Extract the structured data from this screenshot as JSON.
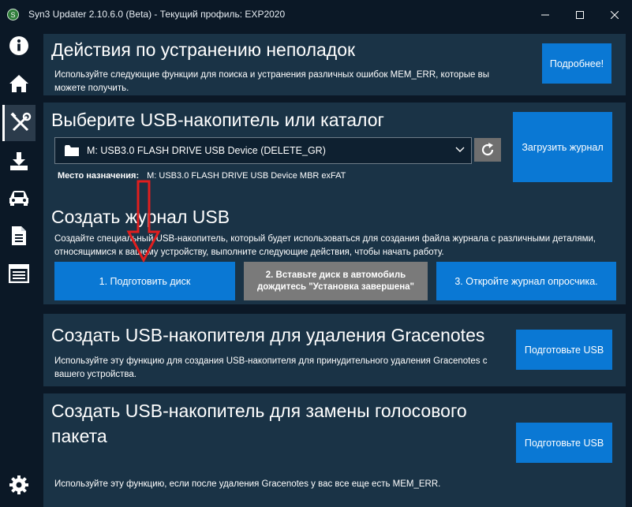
{
  "window": {
    "title": "Syn3 Updater 2.10.6.0 (Beta) - Текущий профиль: EXP2020"
  },
  "sidebar": {
    "items": [
      {
        "icon": "info-icon"
      },
      {
        "icon": "home-icon"
      },
      {
        "icon": "tools-icon",
        "active": true
      },
      {
        "icon": "download-icon"
      },
      {
        "icon": "car-icon"
      },
      {
        "icon": "document-icon"
      },
      {
        "icon": "log-icon"
      }
    ],
    "settings_icon": "gear-icon"
  },
  "troubleshoot": {
    "title": "Действия по устранению неполадок",
    "desc": "Используйте следующие функции для поиска и устранения различных ошибок MEM_ERR, которые вы можете получить.",
    "more_button": "Подробнее!"
  },
  "usb_select": {
    "title": "Выберите USB-накопитель или каталог",
    "selected_drive": "M:  USB3.0 FLASH DRIVE USB Device (DELETE_GR)",
    "dest_label": "Место назначения:",
    "dest_value": "M:  USB3.0 FLASH DRIVE USB Device  MBR exFAT",
    "upload_button": "Загрузить журнал"
  },
  "create_log": {
    "title": "Создать журнал USB",
    "desc": "Создайте специальный USB-накопитель, который будет использоваться для создания файла журнала с различными деталями, относящимися к вашему устройству, выполните следующие действия, чтобы начать работу.",
    "step1": "1. Подготовить диск",
    "step2": "2. Вставьте диск в автомобиль дождитесь \"Установка завершена\"",
    "step3": "3. Откройте журнал опросчика."
  },
  "gracenotes_remove": {
    "title": "Создать USB-накопителя для удаления Gracenotes",
    "desc": "Используйте эту функцию для создания USB-накопителя для принудительного удаления Gracenotes с вашего устройства.",
    "button": "Подготовьте USB"
  },
  "voice_replace": {
    "title": "Создать USB-накопитель для замены голосового пакета",
    "desc": "Используйте эту функцию, если после удаления Gracenotes у вас все еще есть MEM_ERR.",
    "button": "Подготовьте USB"
  },
  "colors": {
    "accent_blue": "#0a78d4",
    "panel": "#1a3346",
    "background": "#0b1826",
    "annotation_arrow": "#e01e1e"
  }
}
